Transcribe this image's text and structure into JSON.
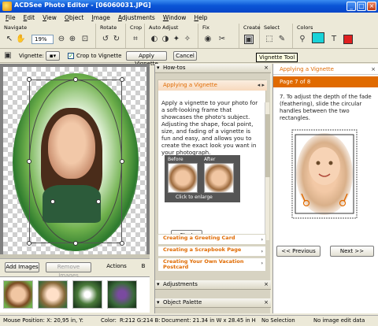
{
  "window": {
    "title": "ACDSee Photo Editor - [06060031.JPG]"
  },
  "menu": [
    "File",
    "Edit",
    "View",
    "Object",
    "Image",
    "Adjustments",
    "Window",
    "Help"
  ],
  "toolbar": {
    "groups": [
      "Navigate",
      "Rotate",
      "Crop",
      "Auto Adjust",
      "Fix",
      "Create",
      "Select",
      "Colors"
    ],
    "zoom": "19%"
  },
  "vignette_bar": {
    "label": "Vignette:",
    "crop_label": "Crop to Vignette",
    "crop_checked": true,
    "apply_label": "Apply Vignette",
    "cancel_label": "Cancel",
    "tooltip": "Vignette Tool"
  },
  "images_panel": {
    "add_label": "Add Images",
    "remove_label": "Remove Images",
    "actions_label": "Actions",
    "b_label": "B"
  },
  "howto": {
    "header": "How-tos",
    "card_title": "Applying a Vignette",
    "body": "Apply a vignette to your photo for a soft-looking frame that showcases the photo's subject. Adjusting the shape, focal point, size, and fading of a vignette is fun and easy, and allows you to create the exact look you want in your photograph.",
    "before": "Before",
    "after": "After",
    "enlarge": "Click to enlarge",
    "start_label": "Start",
    "links": [
      "Creating a Greeting Card",
      "Creating a Scrapbook Page",
      "Creating Your Own Vacation Postcard"
    ],
    "sections": [
      "Adjustments",
      "Object Palette"
    ]
  },
  "steps": {
    "title": "Applying a Vignette",
    "page": "Page 7 of 8",
    "text": "7. To adjust the depth of the fade (feathering), slide the circular handles between the two rectangles.",
    "prev_label": "<< Previous",
    "next_label": "Next >>"
  },
  "status": {
    "mouse": "Mouse Position: X: 20,95 in, Y:",
    "color": "Color:",
    "rgb": "R:212  G:214  B:",
    "document": "Document: 21.34 in W x 28.45 in H",
    "selection": "No Selection",
    "right": "No image edit data"
  },
  "colors": {
    "accent": "#e06a00",
    "titlebar": "#0a55d6",
    "fg_swatch": "#19d3d8",
    "bg_swatch": "#e02020"
  }
}
